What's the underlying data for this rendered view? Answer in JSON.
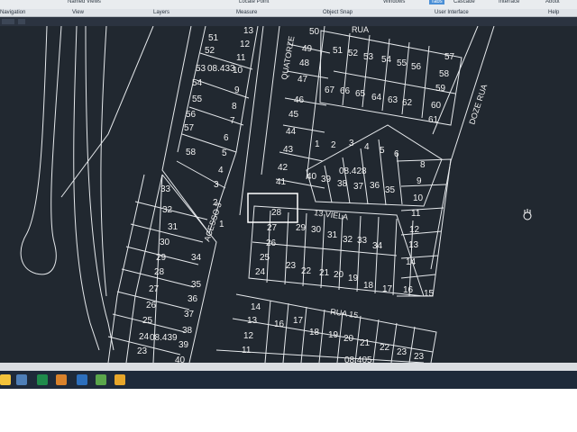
{
  "ribbon": {
    "top_items": [
      "Named Views",
      "Locate Point",
      "Windows",
      "Tabs",
      "Cascade",
      "Interface",
      "About"
    ],
    "panels": [
      "Navigation",
      "View",
      "Layers",
      "Measure",
      "Object Snap",
      "User Interface",
      "Help"
    ]
  },
  "drawing": {
    "streets": [
      "RUA",
      "QUATORZE",
      "DOZE RUA",
      "VIELA",
      "RUA 15",
      "ACESSO 3"
    ],
    "lot_area_labels": [
      "08.433",
      "08.428",
      "08.439",
      "08.405"
    ],
    "block_a_lots_right": [
      "13",
      "12",
      "11",
      "10",
      "9",
      "8",
      "7",
      "6",
      "5",
      "4",
      "3",
      "2",
      "1"
    ],
    "block_a_lots_left": [
      "51",
      "52",
      "54",
      "55",
      "56",
      "57",
      "58"
    ],
    "block_b_lots": [
      "50",
      "49",
      "48",
      "47",
      "46",
      "45",
      "44",
      "43",
      "42",
      "41"
    ],
    "block_c_top_lots": [
      "51",
      "52",
      "53",
      "54",
      "55",
      "56",
      "57",
      "58",
      "59",
      "60",
      "61"
    ],
    "block_c_row2_lots": [
      "67",
      "66",
      "65",
      "64",
      "63",
      "62"
    ],
    "block_d_lots": [
      "1",
      "2",
      "3",
      "4",
      "5",
      "6"
    ],
    "block_d_lower": [
      "40",
      "39",
      "38",
      "37",
      "36",
      "35"
    ],
    "block_e_lots": [
      "8",
      "9",
      "10",
      "11",
      "12",
      "13",
      "14",
      "15"
    ],
    "highlighted_lot": "28",
    "viela_row_top": [
      "27",
      "29",
      "30",
      "31",
      "32",
      "33",
      "34"
    ],
    "viela_row_bottom": [
      "26",
      "25",
      "24",
      "23",
      "22",
      "21",
      "20",
      "19",
      "18",
      "17",
      "16",
      "15"
    ],
    "left_block_lots_a": [
      "33",
      "32",
      "31",
      "30",
      "29",
      "28",
      "27",
      "26",
      "25",
      "24",
      "23"
    ],
    "left_block_lots_b": [
      "34",
      "35",
      "36",
      "37",
      "38",
      "39",
      "40"
    ],
    "bottom_block_lots": [
      "14",
      "13",
      "12",
      "11",
      "16",
      "17",
      "18",
      "19",
      "20",
      "21",
      "22",
      "23"
    ],
    "viela_label": "13 VIELA"
  },
  "colors": {
    "canvas": "#212830",
    "lines": "#e6e9ec",
    "text": "#f2f2f2",
    "highlight": "#ffffff"
  }
}
